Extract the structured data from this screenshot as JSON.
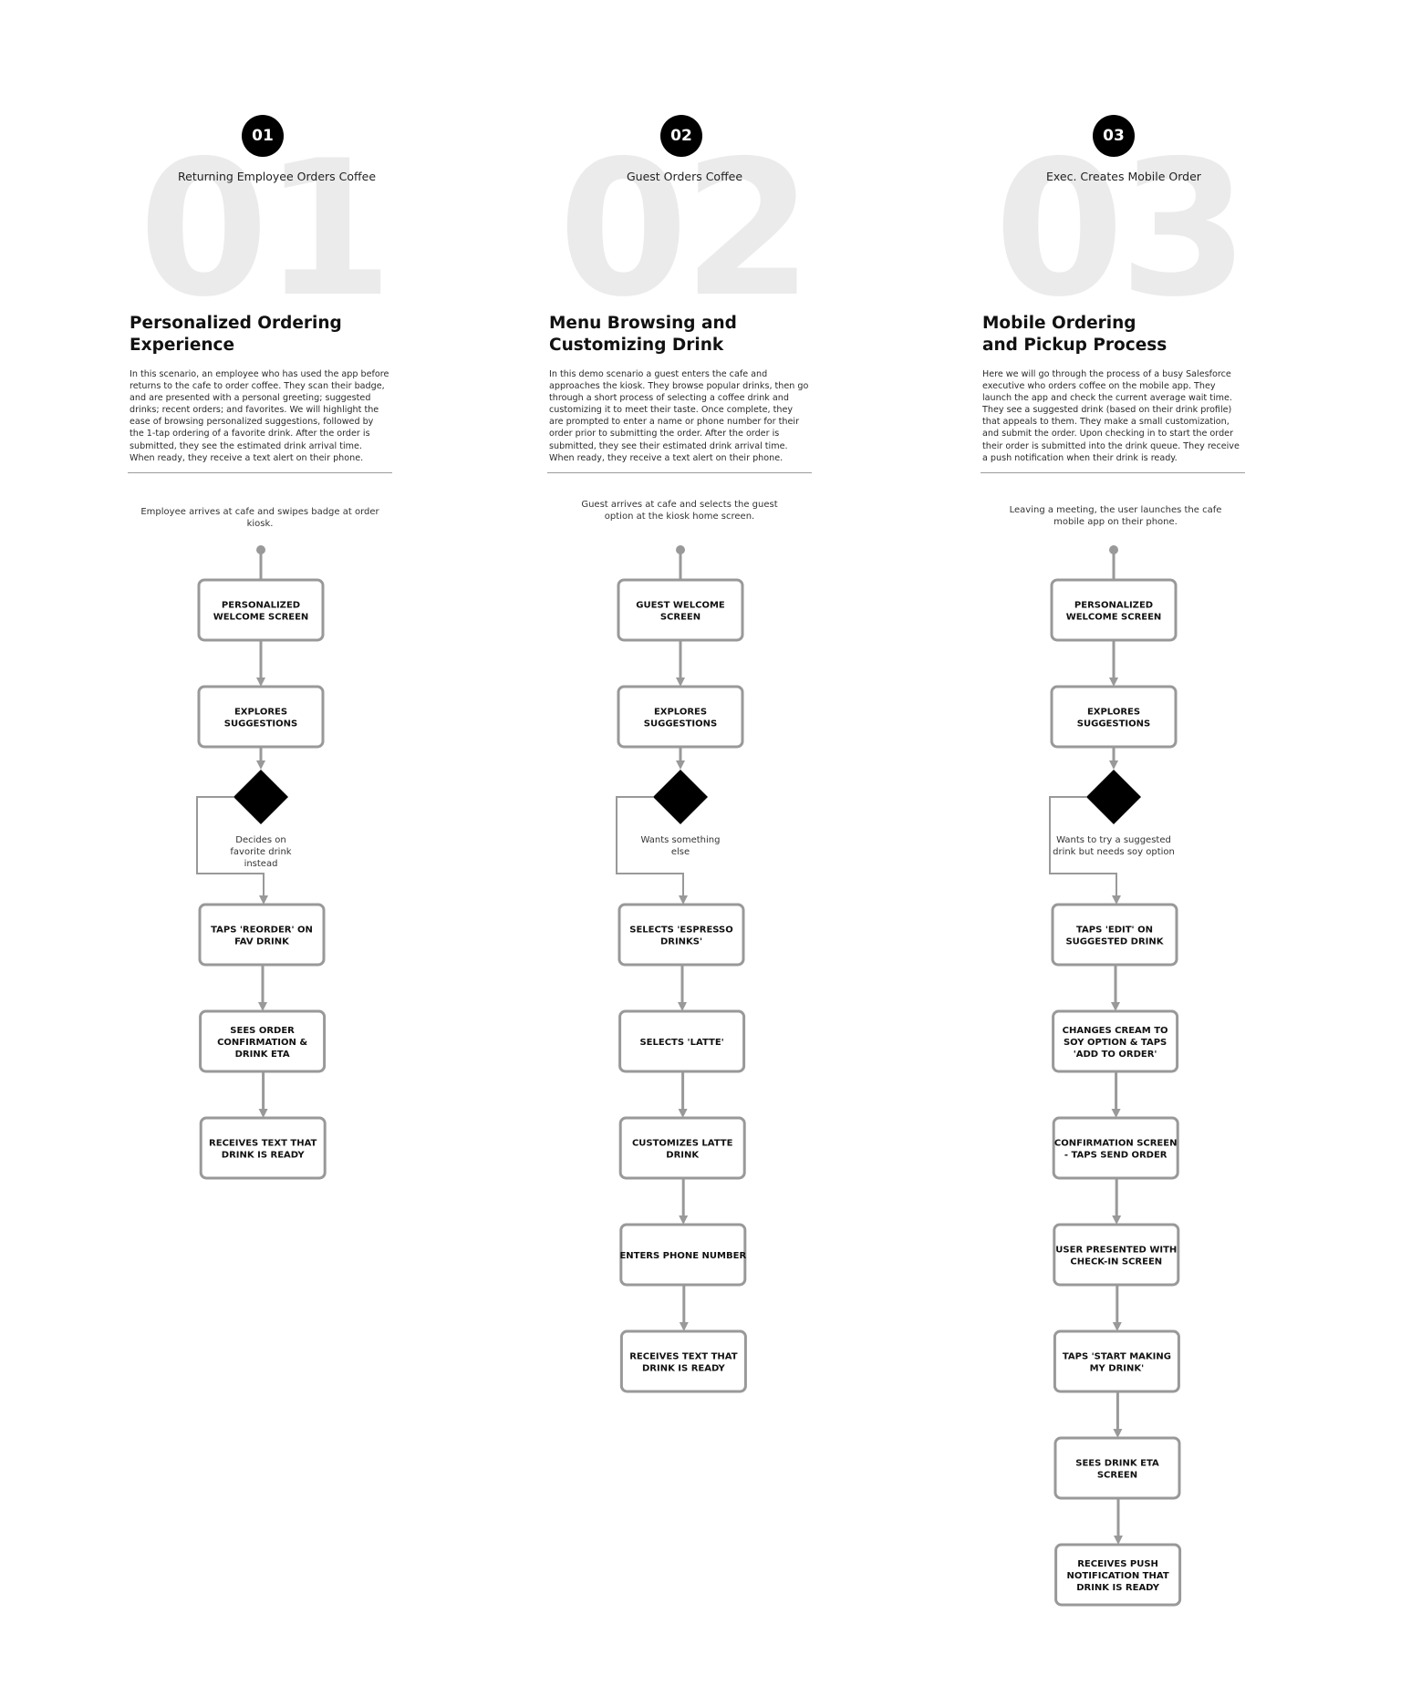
{
  "scenarios": [
    {
      "number": "01",
      "subtitle": "Returning Employee Orders Coffee",
      "title_lines": [
        "Personalized Ordering",
        "Experience"
      ],
      "description": "In this scenario, an employee who has used the app before returns to the cafe to order coffee. They scan their badge, and are presented with a personal greeting; suggested drinks; recent orders; and favorites. We will highlight the ease of browsing personalized suggestions, followed by the 1-tap ordering of a favorite drink. After the order is submitted, they see the estimated drink arrival time. When ready, they receive a text alert on their phone.",
      "start_note": "Employee arrives at cafe and swipes badge at order kiosk.",
      "decision_label": "Decides on favorite drink instead",
      "steps_before_decision": [
        "PERSONALIZED WELCOME SCREEN",
        "EXPLORES SUGGESTIONS"
      ],
      "steps_after_decision": [
        "TAPS 'REORDER' ON FAV DRINK",
        "SEES ORDER CONFIRMATION & DRINK ETA",
        "RECEIVES TEXT THAT DRINK IS READY"
      ]
    },
    {
      "number": "02",
      "subtitle": "Guest Orders Coffee",
      "title_lines": [
        "Menu Browsing and",
        "Customizing Drink"
      ],
      "description": "In this demo scenario a guest enters the cafe and approaches the kiosk. They browse popular drinks, then go through a short process of selecting a coffee drink and customizing it to meet their taste. Once complete, they are prompted to enter a name or phone number for their order prior to submitting the order. After the order is submitted, they see their estimated drink arrival time. When ready, they receive a text alert on their phone.",
      "start_note": "Guest arrives at cafe and selects the guest option at the kiosk home screen.",
      "decision_label": "Wants something else",
      "steps_before_decision": [
        "GUEST WELCOME SCREEN",
        "EXPLORES SUGGESTIONS"
      ],
      "steps_after_decision": [
        "SELECTS 'ESPRESSO DRINKS'",
        "SELECTS 'LATTE'",
        "CUSTOMIZES LATTE DRINK",
        "ENTERS PHONE NUMBER",
        "RECEIVES TEXT THAT DRINK IS READY"
      ]
    },
    {
      "number": "03",
      "subtitle": "Exec. Creates Mobile Order",
      "title_lines": [
        "Mobile Ordering",
        "and Pickup Process"
      ],
      "description": "Here we will go through the process of a busy Salesforce executive who orders coffee on the mobile app. They launch the app and check the current average wait time. They see a suggested drink (based on their drink profile) that appeals to them. They make a small customization, and submit the order. Upon checking in to start the order their order is submitted into the drink queue. They receive a push notification when their drink is ready.",
      "start_note": "Leaving a meeting, the user launches the cafe mobile app on their phone.",
      "decision_label": "Wants to try a suggested drink but needs soy option",
      "steps_before_decision": [
        "PERSONALIZED WELCOME SCREEN",
        "EXPLORES SUGGESTIONS"
      ],
      "steps_after_decision": [
        "TAPS 'EDIT' ON SUGGESTED DRINK",
        "CHANGES CREAM TO SOY OPTION & TAPS 'ADD TO ORDER'",
        "CONFIRMATION SCREEN - TAPS SEND ORDER",
        "USER PRESENTED WITH CHECK-IN SCREEN",
        "TAPS 'START MAKING MY DRINK'",
        "SEES DRINK ETA SCREEN",
        "RECEIVES PUSH NOTIFICATION THAT DRINK IS READY"
      ]
    }
  ],
  "colors": {
    "connector": "#999999",
    "box_border": "#999999",
    "decision_fill": "#000000",
    "badge_fill": "#000000",
    "watermark": "#ebebeb"
  }
}
